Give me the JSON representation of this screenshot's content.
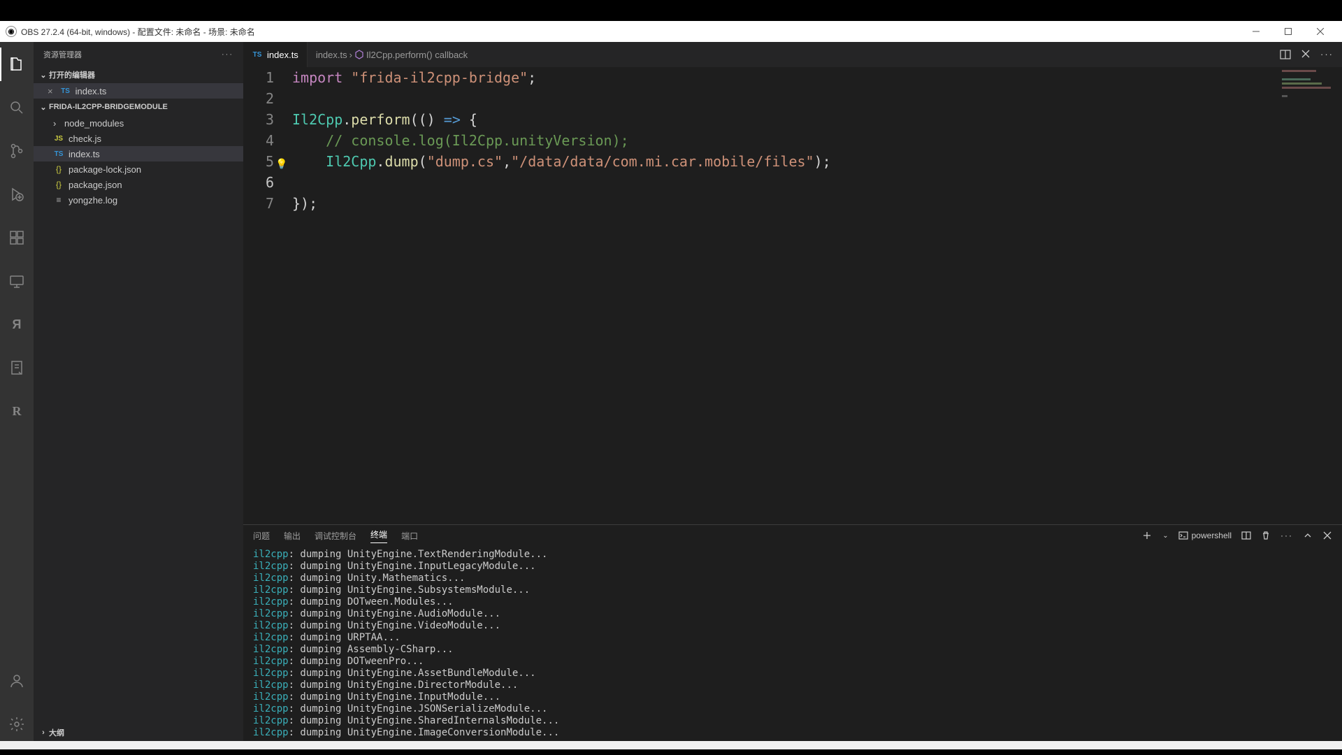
{
  "obs": {
    "title": "OBS 27.2.4 (64-bit, windows) - 配置文件: 未命名 - 场景: 未命名"
  },
  "sidebar": {
    "title": "资源管理器",
    "open_editors_label": "打开的编辑器",
    "project_label": "FRIDA-IL2CPP-BRIDGEMODULE",
    "outline_label": "大纲",
    "open_editors": [
      {
        "icon": "TS",
        "name": "index.ts"
      }
    ],
    "files": [
      {
        "type": "folder",
        "name": "node_modules"
      },
      {
        "type": "js",
        "name": "check.js"
      },
      {
        "type": "ts",
        "name": "index.ts",
        "selected": true
      },
      {
        "type": "json",
        "name": "package-lock.json"
      },
      {
        "type": "json",
        "name": "package.json"
      },
      {
        "type": "txt",
        "name": "yongzhe.log"
      }
    ]
  },
  "tab": {
    "name": "index.ts"
  },
  "breadcrumb": {
    "file": "index.ts",
    "symbol": "Il2Cpp.perform() callback"
  },
  "code": {
    "l1_import": "import",
    "l1_str": "\"frida-il2cpp-bridge\"",
    "l3_cls": "Il2Cpp",
    "l3_fn": "perform",
    "l4_cmt": "// console.log(Il2Cpp.unityVersion);",
    "l5_cls": "Il2Cpp",
    "l5_fn": "dump",
    "l5_arg1": "\"dump.cs\"",
    "l5_arg2": "\"/data/data/com.mi.car.mobile/files\"",
    "line_numbers": [
      "1",
      "2",
      "3",
      "4",
      "5",
      "6",
      "7"
    ]
  },
  "panel_tabs": {
    "problems": "问题",
    "output": "输出",
    "debug": "调试控制台",
    "terminal": "终端",
    "ports": "端口"
  },
  "shell": "powershell",
  "terminal_lines": [
    "dumping UnityEngine.TextRenderingModule...",
    "dumping UnityEngine.InputLegacyModule...",
    "dumping Unity.Mathematics...",
    "dumping UnityEngine.SubsystemsModule...",
    "dumping DOTween.Modules...",
    "dumping UnityEngine.AudioModule...",
    "dumping UnityEngine.VideoModule...",
    "dumping URPTAA...",
    "dumping Assembly-CSharp...",
    "dumping DOTweenPro...",
    "dumping UnityEngine.AssetBundleModule...",
    "dumping UnityEngine.DirectorModule...",
    "dumping UnityEngine.InputModule...",
    "dumping UnityEngine.JSONSerializeModule...",
    "dumping UnityEngine.SharedInternalsModule...",
    "dumping UnityEngine.ImageConversionModule..."
  ],
  "terminal_tag": "il2cpp"
}
